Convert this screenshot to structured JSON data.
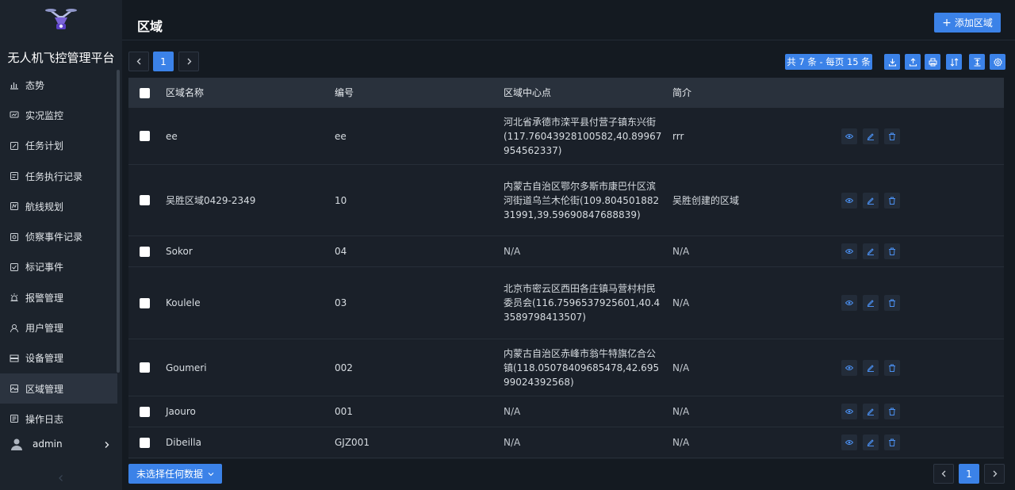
{
  "app": {
    "title": "无人机飞控管理平台"
  },
  "sidebar": {
    "items": [
      {
        "label": "态势",
        "icon": "chart-icon",
        "active": false
      },
      {
        "label": "实况监控",
        "icon": "monitor-icon",
        "active": false
      },
      {
        "label": "任务计划",
        "icon": "plan-icon",
        "active": false
      },
      {
        "label": "任务执行记录",
        "icon": "record-icon",
        "active": false
      },
      {
        "label": "航线规划",
        "icon": "route-icon",
        "active": false
      },
      {
        "label": "侦察事件记录",
        "icon": "scout-icon",
        "active": false
      },
      {
        "label": "标记事件",
        "icon": "mark-icon",
        "active": false
      },
      {
        "label": "报警管理",
        "icon": "alarm-icon",
        "active": false
      },
      {
        "label": "用户管理",
        "icon": "user-icon",
        "active": false
      },
      {
        "label": "设备管理",
        "icon": "device-icon",
        "active": false
      },
      {
        "label": "区域管理",
        "icon": "area-icon",
        "active": true
      },
      {
        "label": "操作日志",
        "icon": "log-icon",
        "active": false
      }
    ],
    "user": {
      "name": "admin"
    }
  },
  "header": {
    "title": "区域",
    "add_button": "添加区域"
  },
  "pager": {
    "current_page": "1",
    "summary": "共 7 条 - 每页 15 条"
  },
  "table": {
    "columns": {
      "name": "区域名称",
      "code": "编号",
      "center": "区域中心点",
      "intro": "简介"
    },
    "rows": [
      {
        "name": "ee",
        "code": "ee",
        "center": "河北省承德市滦平县付营子镇东兴街(117.76043928100582,40.89967954562337)",
        "intro": "rrr"
      },
      {
        "name": "吴胜区域0429-2349",
        "code": "10",
        "center": "内蒙古自治区鄂尔多斯市康巴什区滨河街道乌兰木伦街(109.80450188231991,39.59690847688839)",
        "intro": "吴胜创建的区域"
      },
      {
        "name": "Sokor",
        "code": "04",
        "center": "N/A",
        "intro": "N/A"
      },
      {
        "name": "Koulele",
        "code": "03",
        "center": "北京市密云区西田各庄镇马营村村民委员会(116.7596537925601,40.43589798413507)",
        "intro": "N/A"
      },
      {
        "name": "Goumeri",
        "code": "002",
        "center": "内蒙古自治区赤峰市翁牛特旗亿合公镇(118.05078409685478,42.69599024392568)",
        "intro": "N/A"
      },
      {
        "name": "Jaouro",
        "code": "001",
        "center": "N/A",
        "intro": "N/A"
      },
      {
        "name": "Dibeilla",
        "code": "GJZ001",
        "center": "N/A",
        "intro": "N/A"
      }
    ]
  },
  "footer": {
    "selection_label": "未选择任何数据",
    "current_page": "1"
  },
  "colors": {
    "accent": "#3b82e8",
    "background": "#141a21",
    "sidebar": "#1c232c",
    "action_icon": "#4a8ff0"
  }
}
